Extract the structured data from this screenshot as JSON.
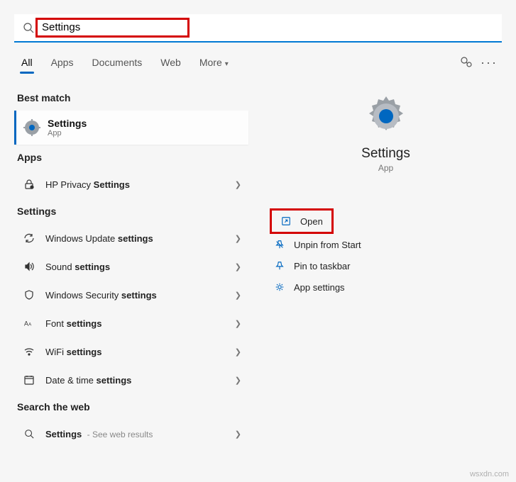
{
  "search": {
    "value": "Settings"
  },
  "tabs": {
    "all": "All",
    "apps": "Apps",
    "documents": "Documents",
    "web": "Web",
    "more": "More"
  },
  "sections": {
    "best_match": "Best match",
    "apps": "Apps",
    "settings": "Settings",
    "search_web": "Search the web"
  },
  "best_match": {
    "title": "Settings",
    "subtitle": "App"
  },
  "apps": {
    "hp_privacy": {
      "prefix": "HP Privacy ",
      "match": "Settings"
    }
  },
  "settings_list": {
    "windows_update": {
      "prefix": "Windows Update ",
      "match": "settings"
    },
    "sound": {
      "prefix": "Sound ",
      "match": "settings"
    },
    "security": {
      "prefix": "Windows Security ",
      "match": "settings"
    },
    "font": {
      "prefix": "Font ",
      "match": "settings"
    },
    "wifi": {
      "prefix": "WiFi ",
      "match": "settings"
    },
    "date_time": {
      "prefix": "Date & time ",
      "match": "settings"
    }
  },
  "web": {
    "settings": {
      "match": "Settings",
      "sub": " - See web results"
    }
  },
  "hero": {
    "title": "Settings",
    "subtitle": "App"
  },
  "actions": {
    "open": "Open",
    "unpin": "Unpin from Start",
    "pin_taskbar": "Pin to taskbar",
    "app_settings": "App settings"
  },
  "watermark": "wsxdn.com"
}
